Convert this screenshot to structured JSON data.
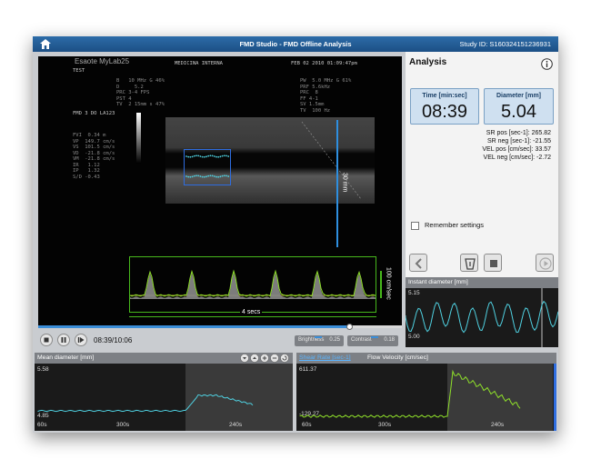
{
  "window": {
    "title": "FMD Studio - FMD Offline Analysis",
    "study_id": "Study ID:  S160324151236931"
  },
  "ultrasound": {
    "logo": "Esaote MyLab25",
    "patient_label": "TEST",
    "dept": "MEDICINA INTERNA",
    "datetime": "FEB 02 2010 01:09:47pm",
    "left_params": "B   10 MHz G 46%\nD     5.2\nPRC 3-4 FPS\nPST 4\nTV  2 15mm s 47%",
    "right_params": "PW  5.0 MHz G 61%\nPRF 5.6kHz\nPRC  8\nFF 4-1\nSV 1.5mm\nTV  100 Hz",
    "study_label": "FMD 3 DO LA123",
    "measure_text": "FVI  0.34 m\nVP  149.7 cm/s\nVS  101.5 cm/s\nVD  -21.8 cm/s\nVM  -21.8 cm/s\nIR   1.12\nIP   1.32\nS/D -0.43",
    "depth_label": "30 mm",
    "doppler_scale": "100 cm/sec",
    "doppler_time": "4 secs"
  },
  "playback": {
    "time": "08:39/10:06",
    "brightness_label": "Brightness",
    "brightness_value": "0.25",
    "contrast_label": "Contrast",
    "contrast_value": "0.18",
    "progress": 0.855
  },
  "analysis": {
    "title": "Analysis",
    "time_label": "Time [min:sec]",
    "time_value": "08:39",
    "diameter_label": "Diameter [mm]",
    "diameter_value": "5.04",
    "sr_pos": "SR pos [sec-1]: 265.82",
    "sr_neg": "SR neg [sec-1]: -21.55",
    "vel_pos": "VEL pos [cm/sec]: 33.57",
    "vel_neg": "VEL neg [cm/sec]: -2.72",
    "remember": "Remember settings"
  },
  "instant_panel": {
    "title": "Instant diameter [mm]",
    "ymax": "5.15",
    "ymin": "5.00"
  },
  "mean_panel": {
    "title": "Mean diameter [mm]",
    "ymax": "5.58",
    "ymin": "4.85",
    "x_labels": [
      "60s",
      "300s",
      "240s"
    ]
  },
  "shear_panel": {
    "title_active": "Shear Rate [sec-1]",
    "title_inactive": "Flow Velocity [cm/sec]",
    "ymax": "611.37",
    "ymin": "-129.27",
    "x_labels": [
      "60s",
      "300s",
      "240s"
    ]
  },
  "colors": {
    "accent_blue": "#2d6ca8",
    "trace_cyan": "#4fd0e0",
    "trace_green": "#8fe02a",
    "doppler_green": "#47b81c"
  }
}
